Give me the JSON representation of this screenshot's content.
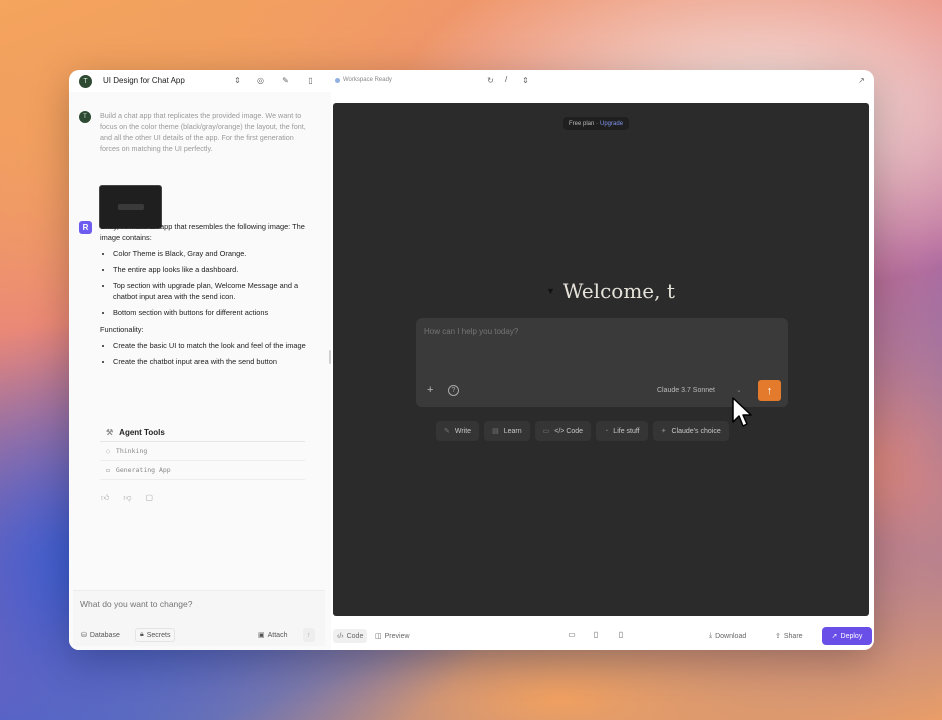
{
  "topbar": {
    "app_initial": "T",
    "app_title": "UI Design for Chat App",
    "workspace_status": "Workspace Ready",
    "path": "/"
  },
  "chat": {
    "user_initial": "T",
    "user_message": "Build a chat app that replicates the provided image. We want to focus on the color theme (black/gray/orange) the layout, the font, and all the other UI details of the app. For the first generation forces on matching the UI perfectly.",
    "ai_initial": "R",
    "ai_intro": "Okay, I'll make an app that resembles the following image: The image contains:",
    "ai_bullets": [
      "Color Theme is Black, Gray and Orange.",
      "The entire app looks like a dashboard.",
      "Top section with upgrade plan, Welcome Message and a chatbot input area with the send icon.",
      "Bottom section with buttons for different actions"
    ],
    "functionality_label": "Functionality:",
    "functionality_bullets": [
      "Create the basic UI to match the look and feel of the image",
      "Create the chatbot input area with the send button"
    ],
    "tools_title": "Agent Tools",
    "tool_rows": [
      "Thinking",
      "Generating App"
    ]
  },
  "composer": {
    "placeholder": "What do you want to change?",
    "database_label": "Database",
    "secrets_label": "Secrets",
    "attach_label": "Attach"
  },
  "preview": {
    "plan_text": "Free plan ·",
    "upgrade_text": "Upgrade",
    "welcome_text": "Welcome, t",
    "chat_placeholder": "How can I help you today?",
    "model_label": "Claude 3.7 Sonnet",
    "actions": [
      {
        "icon": "pencil-icon",
        "label": "Write"
      },
      {
        "icon": "book-icon",
        "label": "Learn"
      },
      {
        "icon": "code-icon",
        "label": "</> Code"
      },
      {
        "icon": "coffee-icon",
        "label": "Life stuff"
      },
      {
        "icon": "sparkle-icon",
        "label": "Claude's choice"
      }
    ]
  },
  "bottombar": {
    "code_tab": "Code",
    "preview_tab": "Preview",
    "download_label": "Download",
    "share_label": "Share",
    "deploy_label": "Deploy"
  },
  "colors": {
    "accent_orange": "#e47a2c",
    "deploy_purple": "#6a4ee8",
    "preview_bg": "#2b2b2b"
  }
}
